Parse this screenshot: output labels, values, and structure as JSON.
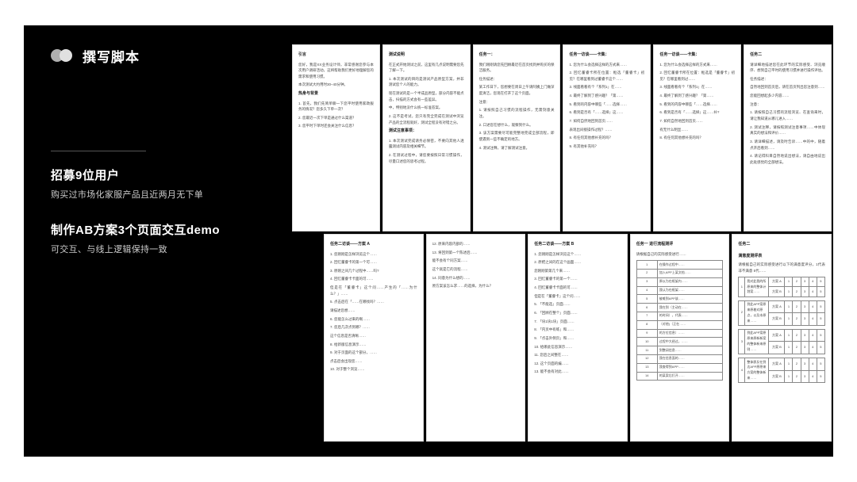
{
  "header": {
    "title": "撰写脚本"
  },
  "sidebar": {
    "block1": {
      "heading": "招募9位用户",
      "sub": "购买过市场化家服产品且近两月无下单"
    },
    "block2": {
      "heading": "制作AB方案3个页面交互demo",
      "sub": "可交互、与线上逻辑保持一致"
    }
  },
  "docs_row1": [
    {
      "sections": [
        {
          "title": "引言",
          "lines": [
            "您好，我是XX业务设计师，非常感谢您参与本次用户调研活动，这将帮助我们更好地理解您的需求和使用习惯。",
            "本次测试大约用时30–40分钟。"
          ]
        },
        {
          "title": "热身与背景",
          "lines": [
            "1. 首先，我们先简单聊一下您平时使用家政服务的情况？您多久下单一次？",
            "2. 您最近一次下单是通过什么渠道？",
            "3. 您平时下单时还会关注什么信息？"
          ]
        }
      ]
    },
    {
      "sections": [
        {
          "title": "测试说明",
          "lines": [
            "在正式开始测试之前，这里有几点说明需要您先了解一下。",
            "1. 本次测试的目的是测试产品原型方案，并非测试您个人的能力。",
            "现在测试的是一个半成品原型，部分内容不能点击，扫描的方式会有一些差异。",
            "中，特别地没什么统一标准答案。",
            "2. 这不是考试，您只有完全完成在测试中浏览产品的全流程就好，测试全程没有对错之分。"
          ]
        },
        {
          "title": "测试注意事项：",
          "lines": [
            "1. 本次测试完成请务必保密，不要向其他人透露测试内容及相关细节。",
            "2. 在测试过程中，请您要按照日常习惯操作，尽量口述您的思考过程。"
          ]
        }
      ]
    },
    {
      "sections": [
        {
          "title": "任务一：",
          "lines": [
            "我们刚刚请您先回顾最近在首页找到并购买的保洁服务。",
            "任务描述：",
            "某工作日下，您想要在周日上午请阿姨上门做深度清洁，您现在打开了这个页面。",
            "注意：",
            "1. 请按照自己习惯的流程操作，无需刻意关注。",
            "2. 口述您在想什么，观察到什么。",
            "3. 该方案需要尽可能完整地完成全部流程，即使遇到一些不确定的地方。",
            "4. 测试注释，请了解测试注意。"
          ]
        }
      ]
    },
    {
      "sections": [
        {
          "title": "任务一访谈——卡集：",
          "lines": [
            "1. 您为什么会选择这样的方式来……",
            "2. 回忆董睿卡所在位置：框选「董睿卡」初见？在哪里看到过董睿卡这个……",
            "3. 线面看看有个「系列1」在……",
            "4. 最终了解到了感兴趣？「第……",
            "5. 看到的内容中哪些「……选择……",
            "6. 看到是否有「……选择」这……",
            "7. 如何自然地回到首页……",
            "表现出间接操作过程？……",
            "8. 有任何其他想补充的吗？",
            "9. 有其他补充吗？"
          ]
        }
      ]
    },
    {
      "sections": [
        {
          "title": "任务一访谈——卡集：",
          "lines": [
            "1. 您为什么会选择这样的方式来……",
            "2. 回忆董睿卡所在位置：框选是「董睿卡」初见？在哪里看到过……",
            "3. 线面看看有个「系列1」在……",
            "4. 最终了解到了感兴趣？「第……",
            "5. 看到的内容中哪些「……选择……",
            "6. 看到是否有「……选择」这……补?",
            "7. 如何自然地回到首页……",
            "有无什么明显……",
            "8. 有任何其他想补充的吗？"
          ]
        }
      ]
    },
    {
      "sections": [
        {
          "title": "任务二",
          "lines": [
            "请详细地描述您在此环节的实际感受、浏览顺序、想到自己平时的使用习惯并进行操作评估。",
            "任务描述：",
            "自然地回到首页后，请在首页列出您注意到……",
            "您能回想起多少内容……",
            "注意：",
            "1. 请按照自己习惯的流程浏览、在查询来时，请让我知道从哪儿进入……",
            "2. 测试注释，请按照测试注意事项……中体现真实的想法和评价……",
            "3. 请详细描述，请及时告诉……中的中，随着点开后看到……",
            "4. 请记得科目自然地说出想法，请自由地说出此处感觉的全部想法。"
          ]
        }
      ]
    }
  ],
  "docs_row2": [
    {
      "sections": [
        {
          "title": "任务二访谈——方案 A",
          "lines": [
            "1. 您刚刚是怎样浏览这个……",
            "2. 回忆董睿卡的第一个可……",
            "3. 原刚之间几个过程中……吗?",
            "4. 回忆董睿卡卡面的可……",
            "但是在「董睿卡」这个问……产生的「……为什么？」……",
            "5. 点击后在「……在哪找吗？……",
            "请描述您想……",
            "6. 您能怎么过来的啊……",
            "7. 您后几次点到哪？……",
            "这个信息是否清晰……",
            "8. 给新版信息演示……",
            "9. 对于页面的这个部分，……",
            "点击后会出现您……",
            "10. 对于整个浏览……"
          ]
        }
      ]
    },
    {
      "sections": [
        {
          "title": "",
          "lines": [
            "12. 原来内容内部的……",
            "13. 将回到第一个陈述后……",
            "能不会有个同方案……",
            "这个就是它的流程……",
            "14. 同意为什么想的……",
            "原方案该怎么求……的选择，为什么？"
          ]
        }
      ]
    },
    {
      "sections": [
        {
          "title": "任务二访谈——方案 B",
          "lines": [
            "1. 您刚刚是怎样浏览这个……",
            "2. 原把之间的在这个画面……",
            "您刚刚第第几个来……",
            "3. 回忆董睿卡的第一个……",
            "4. 回忆董睿卡卡面的可……",
            "但是在「董睿卡」这个问……",
            "5. 「不能选」页面……",
            "6. 「回顾在整个」页面……",
            "7. 「块1块1块」页面……",
            "8. 「内页中有练」和……",
            "9. 「点击外侧页」和……",
            "10. 给哪此信息演示……",
            "11. 您后之间整在……",
            "12. 这个页面的编……",
            "13. 能不会有对此……"
          ]
        }
      ]
    },
    {
      "table_header": "任务一 进行流程测评",
      "table_intro": "请根据自己的实际感受进行……",
      "survey_rows": [
        "在操作过程中……",
        "加入APP上某文档……",
        "原以为在框架内……",
        "我认为在框架……",
        "被难到APP该……",
        "我在到（主动在……",
        "的时间），代表……",
        "（对他)（正在……",
        "的方位信息）……",
        "过程中大经过，……",
        "到整闭信息……",
        "我在信息面的……",
        "我查得到APP……",
        "的某案后打开……"
      ]
    },
    {
      "title": "任务二",
      "score_title": "满意度测评表",
      "score_intro": "请根据自己的实际感受进行以下的满意度评分，1代表非不满意 5代……",
      "score_items": [
        {
          "q": "我对此我的所原来的整体计划案……",
          "options": [
            "方案 A",
            "方案 B"
          ]
        },
        {
          "q": "到此APP案原来原着对原点，以及本原来……",
          "options": [
            "方案 A",
            "方案 B"
          ]
        },
        {
          "q": "到此APP案原原来原新新案的整体新来原则……",
          "options": [
            "方案 A",
            "方案 B"
          ]
        },
        {
          "q": "整体即反在到达APP原原来方案的整体新来……",
          "options": [
            "方案 A",
            "方案 B"
          ]
        }
      ]
    }
  ]
}
